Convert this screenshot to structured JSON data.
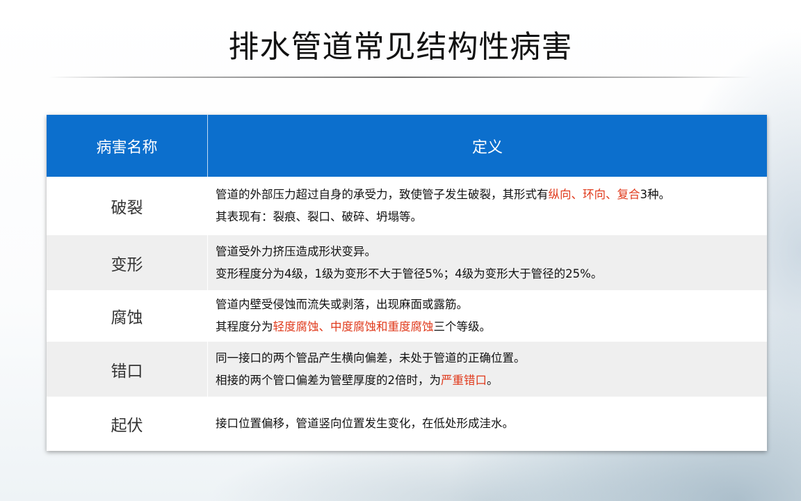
{
  "title": "排水管道常见结构性病害",
  "colors": {
    "header_bg": "#0c6fcd",
    "highlight": "#e03a1c",
    "row_alt": "#efefef"
  },
  "table": {
    "headers": [
      "病害名称",
      "定义"
    ],
    "rows": [
      {
        "name": "破裂",
        "line1": [
          "管道的外部压力超过自身的承受力，致使管子发生破裂，其形式有",
          "纵向、环向、复合",
          "3种。"
        ],
        "line2": [
          "其表现有：裂痕、裂口、破碎、坍塌等。",
          "",
          ""
        ]
      },
      {
        "name": "变形",
        "line1": [
          "管道受外力挤压造成形状变异。",
          "",
          ""
        ],
        "line2": [
          "变形程度分为4级，1级为变形不大于管径5%；4级为变形大于管径的25%。",
          "",
          ""
        ]
      },
      {
        "name": "腐蚀",
        "line1": [
          "管道内壁受侵蚀而流失或剥落，出现麻面或露筋。",
          "",
          ""
        ],
        "line2": [
          "其程度分为",
          "轻度腐蚀、中度腐蚀和重度腐蚀",
          "三个等级。"
        ]
      },
      {
        "name": "错口",
        "line1": [
          "同一接口的两个管品产生横向偏差，未处于管道的正确位置。",
          "",
          ""
        ],
        "line2": [
          "相接的两个管口偏差为管壁厚度的2倍时，为",
          "严重错口",
          "。"
        ]
      },
      {
        "name": "起伏",
        "line1": [
          "接口位置偏移，管道竖向位置发生变化，在低处形成洼水。",
          "",
          ""
        ]
      }
    ]
  }
}
